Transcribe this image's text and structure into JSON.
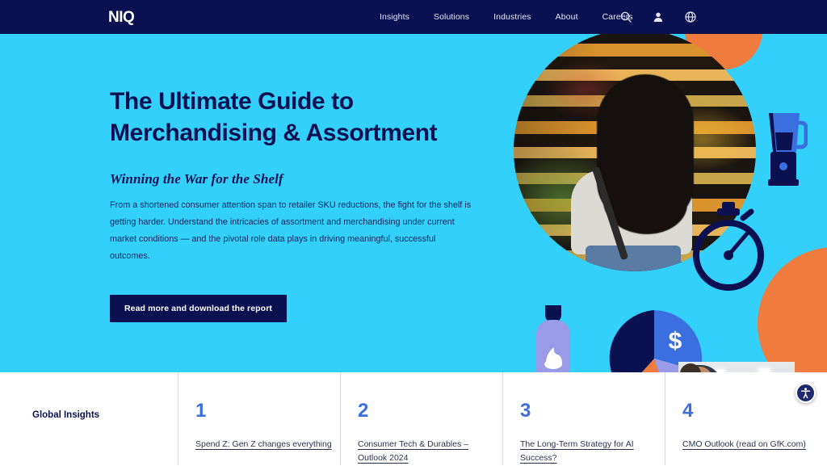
{
  "header": {
    "logo": "NIQ",
    "nav_items": [
      {
        "label": "Insights"
      },
      {
        "label": "Solutions"
      },
      {
        "label": "Industries"
      },
      {
        "label": "About"
      },
      {
        "label": "Careers"
      }
    ],
    "icons": [
      {
        "name": "search-icon"
      },
      {
        "name": "user-icon"
      },
      {
        "name": "globe-icon"
      }
    ]
  },
  "hero": {
    "headline_line1": "The Ultimate Guide to",
    "headline_line2": "Merchandising & Assortment",
    "subhead": "Winning the War for the Shelf",
    "body": "From a shortened consumer attention span to retailer SKU reductions, the fight for the shelf is getting harder. Understand the intricacies of assortment and merchandising under current market conditions — and the pivotal role data plays in driving meaningful, successful outcomes.",
    "cta_label": "Read more and download the report"
  },
  "insights": {
    "section_label": "Global Insights",
    "items": [
      {
        "number": "1",
        "link": "Spend Z: Gen Z changes everything"
      },
      {
        "number": "2",
        "link": "Consumer Tech & Durables – Outlook 2024"
      },
      {
        "number": "3",
        "link": "The Long-Term Strategy for AI Success?"
      },
      {
        "number": "4",
        "link": "CMO Outlook (read on GfK.com)"
      }
    ]
  },
  "accessibility": {
    "widget_name": "accessibility-widget"
  },
  "colors": {
    "navy": "#0B1150",
    "cyan": "#33D0FB",
    "orange": "#F07B3F",
    "royal_blue": "#3B6FE0",
    "periwinkle": "#9A9BE8",
    "white": "#FFFFFF"
  }
}
